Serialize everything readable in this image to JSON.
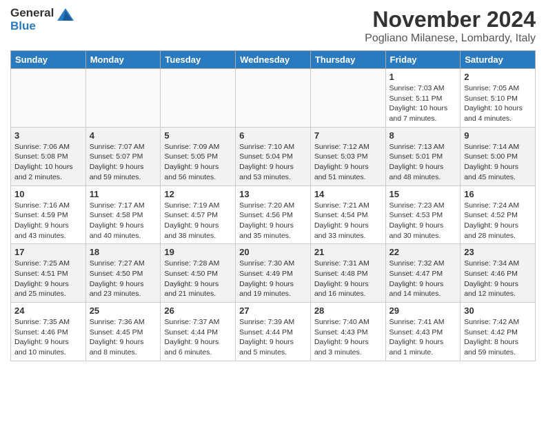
{
  "logo": {
    "line1": "General",
    "line2": "Blue"
  },
  "title": "November 2024",
  "subtitle": "Pogliano Milanese, Lombardy, Italy",
  "days_header": [
    "Sunday",
    "Monday",
    "Tuesday",
    "Wednesday",
    "Thursday",
    "Friday",
    "Saturday"
  ],
  "weeks": [
    [
      {
        "day": "",
        "info": ""
      },
      {
        "day": "",
        "info": ""
      },
      {
        "day": "",
        "info": ""
      },
      {
        "day": "",
        "info": ""
      },
      {
        "day": "",
        "info": ""
      },
      {
        "day": "1",
        "info": "Sunrise: 7:03 AM\nSunset: 5:11 PM\nDaylight: 10 hours and 7 minutes."
      },
      {
        "day": "2",
        "info": "Sunrise: 7:05 AM\nSunset: 5:10 PM\nDaylight: 10 hours and 4 minutes."
      }
    ],
    [
      {
        "day": "3",
        "info": "Sunrise: 7:06 AM\nSunset: 5:08 PM\nDaylight: 10 hours and 2 minutes."
      },
      {
        "day": "4",
        "info": "Sunrise: 7:07 AM\nSunset: 5:07 PM\nDaylight: 9 hours and 59 minutes."
      },
      {
        "day": "5",
        "info": "Sunrise: 7:09 AM\nSunset: 5:05 PM\nDaylight: 9 hours and 56 minutes."
      },
      {
        "day": "6",
        "info": "Sunrise: 7:10 AM\nSunset: 5:04 PM\nDaylight: 9 hours and 53 minutes."
      },
      {
        "day": "7",
        "info": "Sunrise: 7:12 AM\nSunset: 5:03 PM\nDaylight: 9 hours and 51 minutes."
      },
      {
        "day": "8",
        "info": "Sunrise: 7:13 AM\nSunset: 5:01 PM\nDaylight: 9 hours and 48 minutes."
      },
      {
        "day": "9",
        "info": "Sunrise: 7:14 AM\nSunset: 5:00 PM\nDaylight: 9 hours and 45 minutes."
      }
    ],
    [
      {
        "day": "10",
        "info": "Sunrise: 7:16 AM\nSunset: 4:59 PM\nDaylight: 9 hours and 43 minutes."
      },
      {
        "day": "11",
        "info": "Sunrise: 7:17 AM\nSunset: 4:58 PM\nDaylight: 9 hours and 40 minutes."
      },
      {
        "day": "12",
        "info": "Sunrise: 7:19 AM\nSunset: 4:57 PM\nDaylight: 9 hours and 38 minutes."
      },
      {
        "day": "13",
        "info": "Sunrise: 7:20 AM\nSunset: 4:56 PM\nDaylight: 9 hours and 35 minutes."
      },
      {
        "day": "14",
        "info": "Sunrise: 7:21 AM\nSunset: 4:54 PM\nDaylight: 9 hours and 33 minutes."
      },
      {
        "day": "15",
        "info": "Sunrise: 7:23 AM\nSunset: 4:53 PM\nDaylight: 9 hours and 30 minutes."
      },
      {
        "day": "16",
        "info": "Sunrise: 7:24 AM\nSunset: 4:52 PM\nDaylight: 9 hours and 28 minutes."
      }
    ],
    [
      {
        "day": "17",
        "info": "Sunrise: 7:25 AM\nSunset: 4:51 PM\nDaylight: 9 hours and 25 minutes."
      },
      {
        "day": "18",
        "info": "Sunrise: 7:27 AM\nSunset: 4:50 PM\nDaylight: 9 hours and 23 minutes."
      },
      {
        "day": "19",
        "info": "Sunrise: 7:28 AM\nSunset: 4:50 PM\nDaylight: 9 hours and 21 minutes."
      },
      {
        "day": "20",
        "info": "Sunrise: 7:30 AM\nSunset: 4:49 PM\nDaylight: 9 hours and 19 minutes."
      },
      {
        "day": "21",
        "info": "Sunrise: 7:31 AM\nSunset: 4:48 PM\nDaylight: 9 hours and 16 minutes."
      },
      {
        "day": "22",
        "info": "Sunrise: 7:32 AM\nSunset: 4:47 PM\nDaylight: 9 hours and 14 minutes."
      },
      {
        "day": "23",
        "info": "Sunrise: 7:34 AM\nSunset: 4:46 PM\nDaylight: 9 hours and 12 minutes."
      }
    ],
    [
      {
        "day": "24",
        "info": "Sunrise: 7:35 AM\nSunset: 4:46 PM\nDaylight: 9 hours and 10 minutes."
      },
      {
        "day": "25",
        "info": "Sunrise: 7:36 AM\nSunset: 4:45 PM\nDaylight: 9 hours and 8 minutes."
      },
      {
        "day": "26",
        "info": "Sunrise: 7:37 AM\nSunset: 4:44 PM\nDaylight: 9 hours and 6 minutes."
      },
      {
        "day": "27",
        "info": "Sunrise: 7:39 AM\nSunset: 4:44 PM\nDaylight: 9 hours and 5 minutes."
      },
      {
        "day": "28",
        "info": "Sunrise: 7:40 AM\nSunset: 4:43 PM\nDaylight: 9 hours and 3 minutes."
      },
      {
        "day": "29",
        "info": "Sunrise: 7:41 AM\nSunset: 4:43 PM\nDaylight: 9 hours and 1 minute."
      },
      {
        "day": "30",
        "info": "Sunrise: 7:42 AM\nSunset: 4:42 PM\nDaylight: 8 hours and 59 minutes."
      }
    ]
  ]
}
